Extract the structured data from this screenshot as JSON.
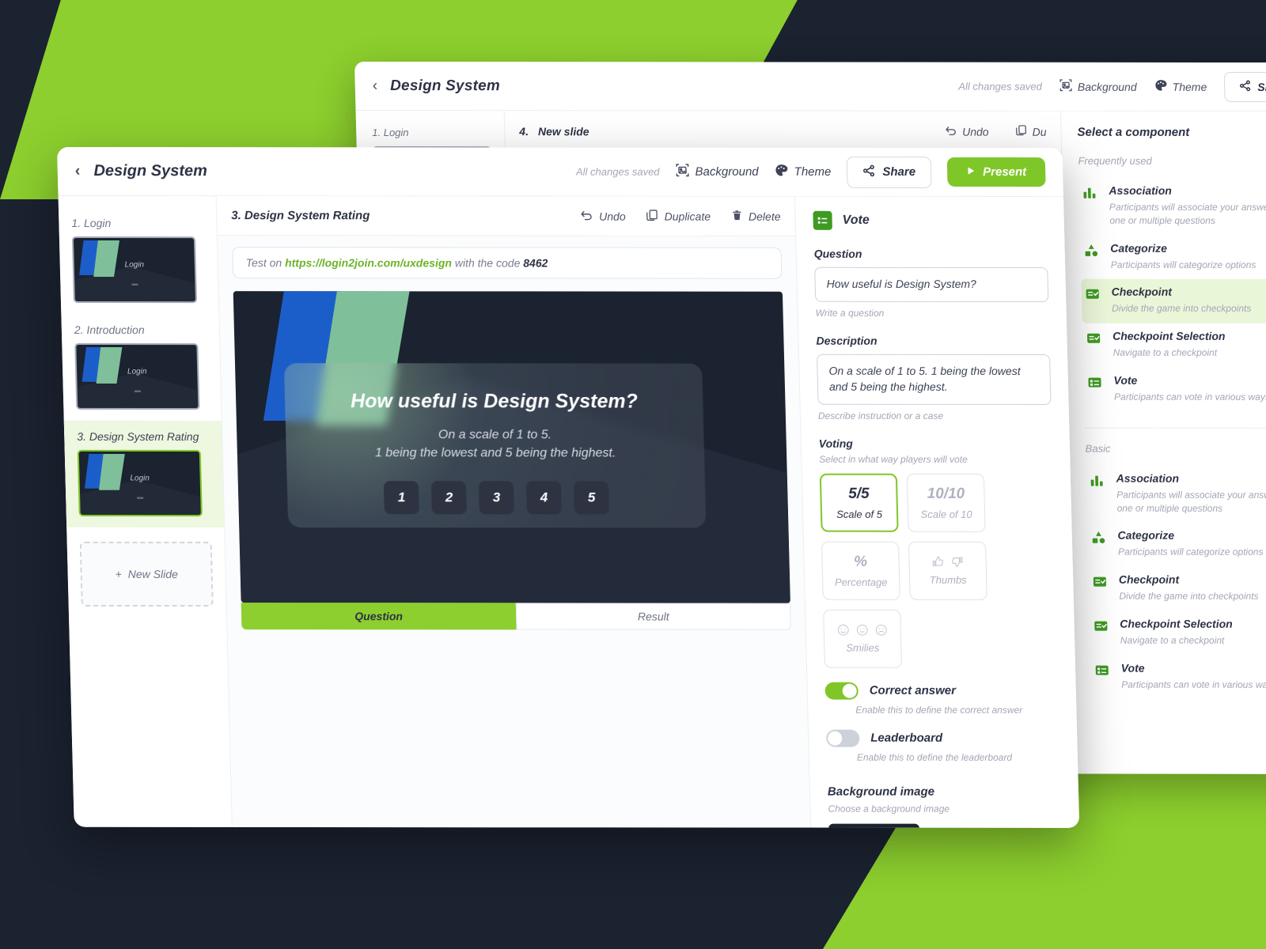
{
  "colors": {
    "brand_green": "#8ccf2e",
    "button_green": "#7fc728",
    "icon_green": "#3f9a22",
    "dark_navy": "#1b2230",
    "text_dark": "#2e3246",
    "muted": "#a3a7b5",
    "slide_blue": "#1c5ec9",
    "slide_mint": "#7fc09a"
  },
  "back_window": {
    "topbar": {
      "back_icon": "chevron-left-icon",
      "title": "Design System",
      "saved_status": "All changes saved",
      "background_label": "Background",
      "background_icon": "image-icon",
      "theme_label": "Theme",
      "theme_icon": "palette-icon",
      "share_label": "Share",
      "share_icon": "share-icon"
    },
    "sidebar": {
      "slides": [
        {
          "label": "1. Login"
        }
      ]
    },
    "slide_header": {
      "number": "4.",
      "name": "New slide"
    },
    "tools": [
      {
        "label": "Undo",
        "icon": "undo-icon"
      },
      {
        "label": "Du",
        "icon": "duplicate-icon"
      }
    ],
    "components_panel": {
      "title": "Select a component",
      "groups": [
        {
          "name": "Frequently used",
          "items": [
            {
              "name": "Association",
              "desc": "Participants will associate your answers with one or multiple questions",
              "icon": "bar-chart-icon",
              "highlighted": false
            },
            {
              "name": "Categorize",
              "desc": "Participants will categorize options",
              "icon": "shapes-icon",
              "highlighted": false
            },
            {
              "name": "Checkpoint",
              "desc": "Divide the game into checkpoints",
              "icon": "checklist-icon",
              "highlighted": true
            },
            {
              "name": "Checkpoint Selection",
              "desc": "Navigate to a checkpoint",
              "icon": "checklist-icon",
              "highlighted": false
            },
            {
              "name": "Vote",
              "desc": "Participants can vote in various ways",
              "icon": "vote-icon",
              "highlighted": false
            }
          ]
        },
        {
          "name": "Basic",
          "items": [
            {
              "name": "Association",
              "desc": "Participants will associate your answers with one or multiple questions",
              "icon": "bar-chart-icon",
              "highlighted": false
            },
            {
              "name": "Categorize",
              "desc": "Participants will categorize options",
              "icon": "shapes-icon",
              "highlighted": false
            },
            {
              "name": "Checkpoint",
              "desc": "Divide the game into checkpoints",
              "icon": "checklist-icon",
              "highlighted": false
            },
            {
              "name": "Checkpoint Selection",
              "desc": "Navigate to a checkpoint",
              "icon": "checklist-icon",
              "highlighted": false
            },
            {
              "name": "Vote",
              "desc": "Participants can vote in various ways",
              "icon": "vote-icon",
              "highlighted": false
            }
          ]
        }
      ]
    }
  },
  "front_window": {
    "topbar": {
      "back_icon": "chevron-left-icon",
      "title": "Design System",
      "saved_status": "All changes saved",
      "background_label": "Background",
      "background_icon": "image-icon",
      "theme_label": "Theme",
      "theme_icon": "palette-icon",
      "share_label": "Share",
      "share_icon": "share-icon",
      "present_label": "Present",
      "present_icon": "play-icon"
    },
    "sidebar": {
      "slides": [
        {
          "label": "1. Login",
          "thumb_text": "Login",
          "active": false
        },
        {
          "label": "2. Introduction",
          "thumb_text": "Login",
          "active": false
        },
        {
          "label": "3. Design System Rating",
          "thumb_text": "Login",
          "active": true
        }
      ],
      "new_slide_label": "New Slide",
      "new_slide_icon": "plus-icon"
    },
    "slide_header": {
      "title": "3. Design System Rating",
      "tools": [
        {
          "label": "Undo",
          "icon": "undo-icon"
        },
        {
          "label": "Duplicate",
          "icon": "duplicate-icon"
        },
        {
          "label": "Delete",
          "icon": "trash-icon"
        }
      ]
    },
    "test_bar": {
      "prefix": "Test on",
      "url": "https://login2join.com/uxdesign",
      "middle": "with the code",
      "code": "8462"
    },
    "preview": {
      "question": "How useful is Design System?",
      "description_line1": "On a scale of 1 to 5.",
      "description_line2": "1 being the lowest and 5 being the highest.",
      "options": [
        "1",
        "2",
        "3",
        "4",
        "5"
      ]
    },
    "tabs": [
      {
        "label": "Question",
        "active": true
      },
      {
        "label": "Result",
        "active": false
      }
    ],
    "properties": {
      "component_name": "Vote",
      "component_icon": "vote-icon",
      "question_label": "Question",
      "question_value": "How useful is Design System?",
      "question_hint": "Write a question",
      "description_label": "Description",
      "description_value": "On a scale of 1 to 5. 1 being the lowest and 5 being the highest.",
      "description_hint": "Describe instruction or a case",
      "voting_label": "Voting",
      "voting_sub": "Select in what way players will vote",
      "voting_options": [
        {
          "big": "5/5",
          "caption": "Scale of 5",
          "selected": true,
          "kind": "text"
        },
        {
          "big": "10/10",
          "caption": "Scale of 10",
          "selected": false,
          "kind": "text"
        },
        {
          "big": "%",
          "caption": "Percentage",
          "selected": false,
          "kind": "text"
        },
        {
          "big": "",
          "caption": "Thumbs",
          "selected": false,
          "kind": "thumbs"
        },
        {
          "big": "",
          "caption": "Smilies",
          "selected": false,
          "kind": "smilies"
        }
      ],
      "correct_answer_label": "Correct answer",
      "correct_answer_hint": "Enable this to define the correct answer",
      "correct_answer_on": true,
      "leaderboard_label": "Leaderboard",
      "leaderboard_hint": "Enable this to define the leaderboard",
      "leaderboard_on": false,
      "background_image_label": "Background image",
      "background_image_sub": "Choose a background image"
    }
  }
}
